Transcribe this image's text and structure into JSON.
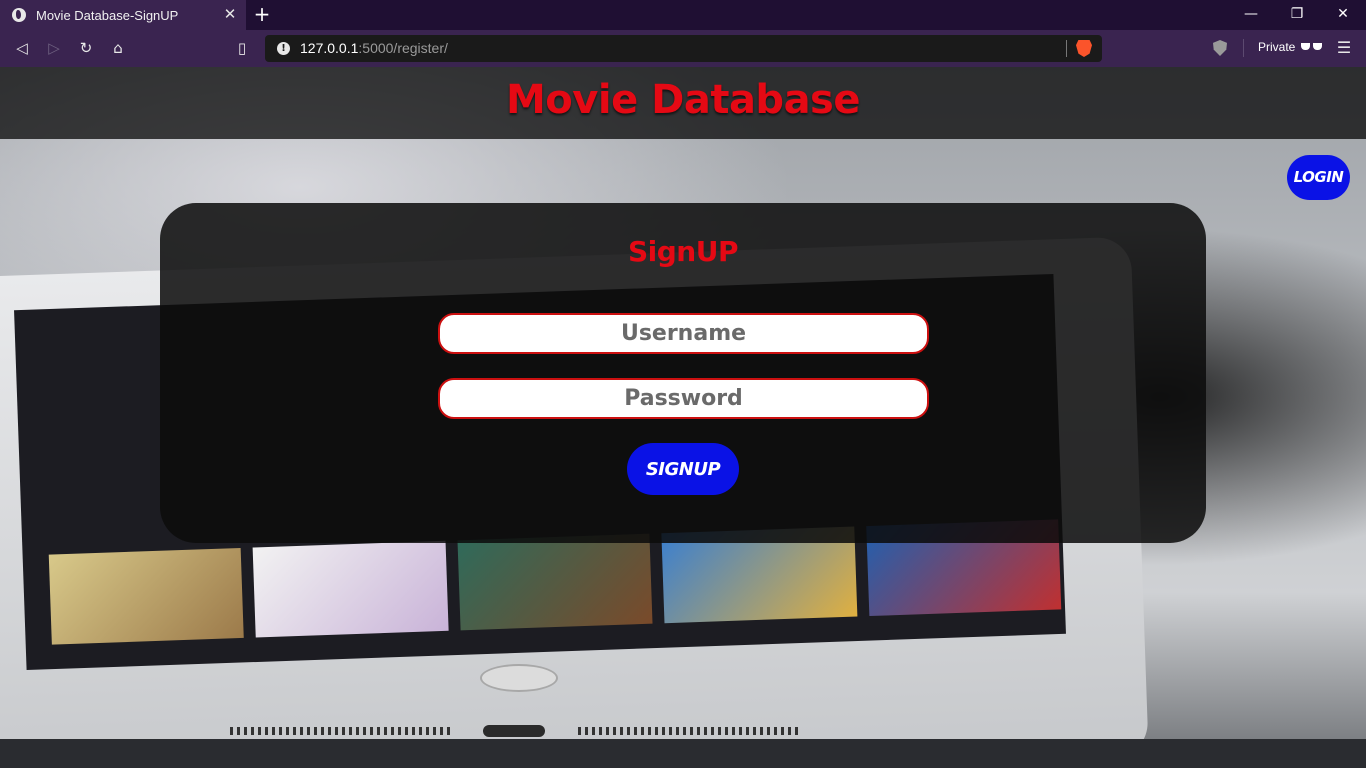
{
  "browser": {
    "tab_title": "Movie Database-SignUP",
    "url_host": "127.0.0.1",
    "url_path": ":5000/register/",
    "private_label": "Private"
  },
  "page": {
    "site_title": "Movie Database",
    "login_label": "LOGIN",
    "form": {
      "title": "SignUP",
      "username_placeholder": "Username",
      "password_placeholder": "Password",
      "submit_label": "SIGNUP"
    }
  },
  "colors": {
    "brand_red": "#e50914",
    "button_blue": "#0a12e6"
  }
}
